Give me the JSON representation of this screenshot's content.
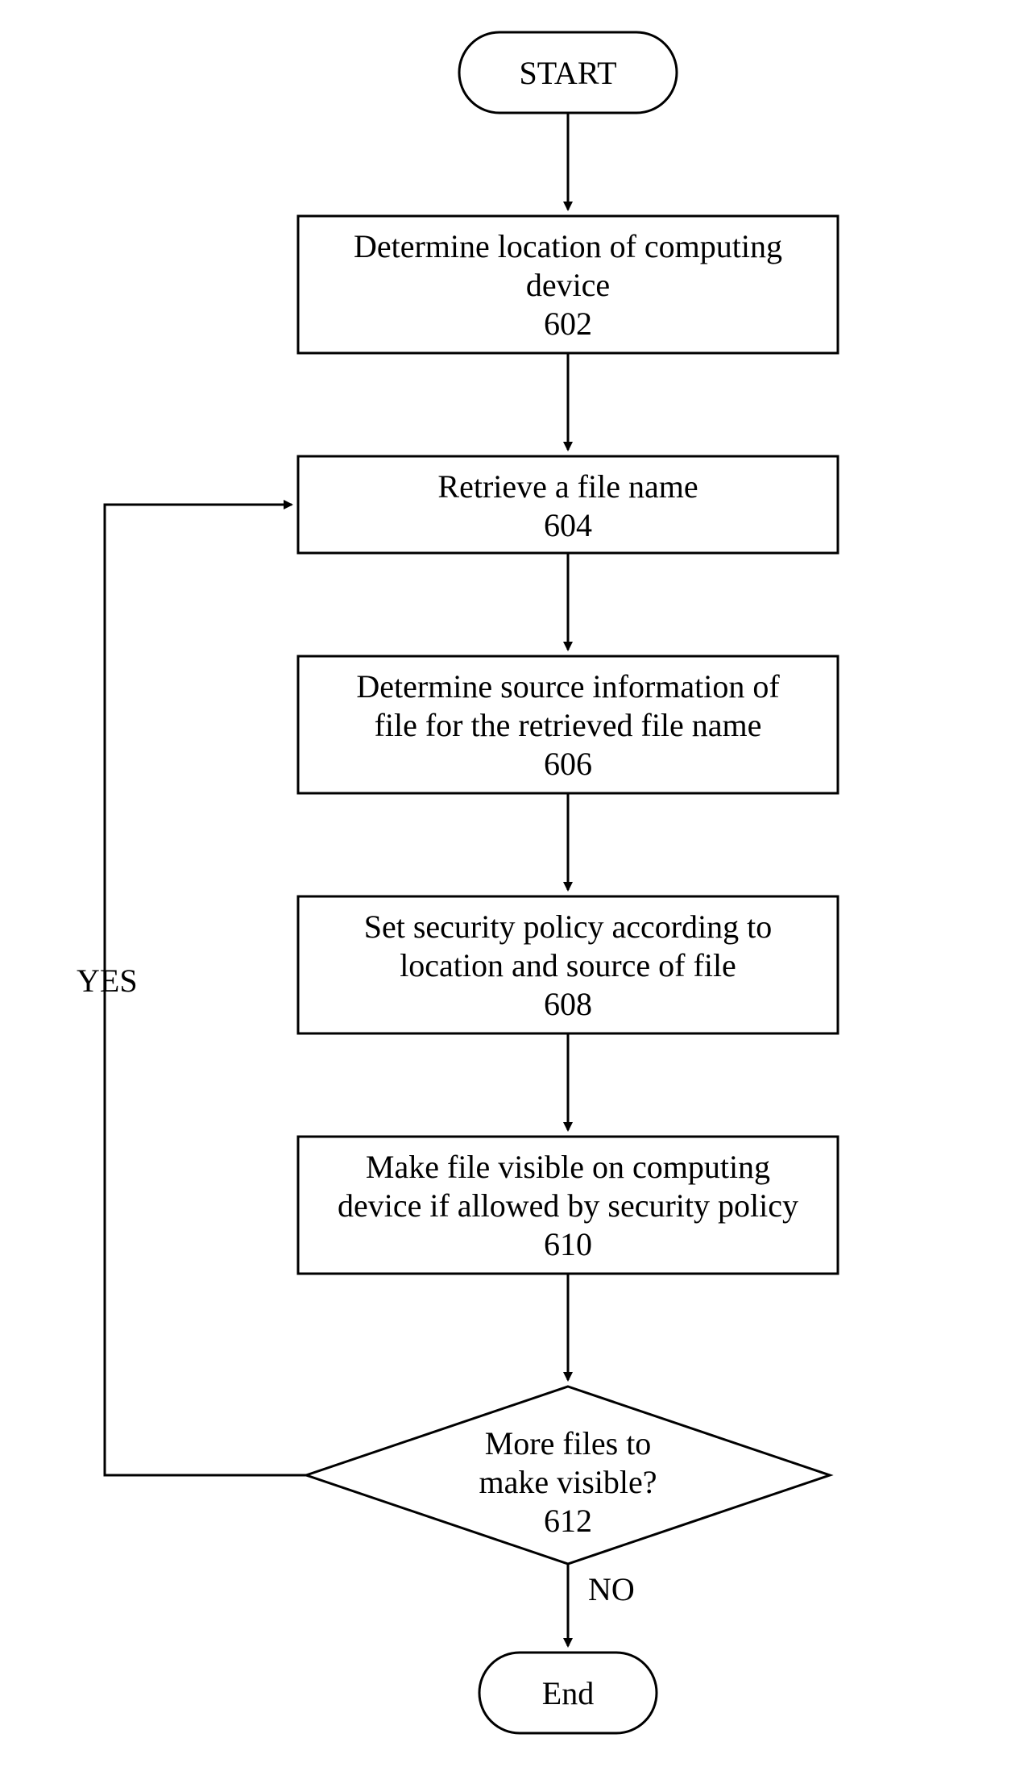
{
  "start": {
    "label": "START"
  },
  "end": {
    "label": "End"
  },
  "steps": {
    "s602": {
      "line1": "Determine location of computing",
      "line2": "device",
      "num": "602"
    },
    "s604": {
      "line1": "Retrieve a file name",
      "num": "604"
    },
    "s606": {
      "line1": "Determine source information of",
      "line2": "file for the retrieved file name",
      "num": "606"
    },
    "s608": {
      "line1": "Set security policy according to",
      "line2": "location and source of file",
      "num": "608"
    },
    "s610": {
      "line1": "Make file visible on computing",
      "line2": "device if allowed by security policy",
      "num": "610"
    }
  },
  "decision": {
    "s612": {
      "line1": "More files to",
      "line2": "make visible?",
      "num": "612"
    }
  },
  "labels": {
    "yes": "YES",
    "no": "NO"
  }
}
